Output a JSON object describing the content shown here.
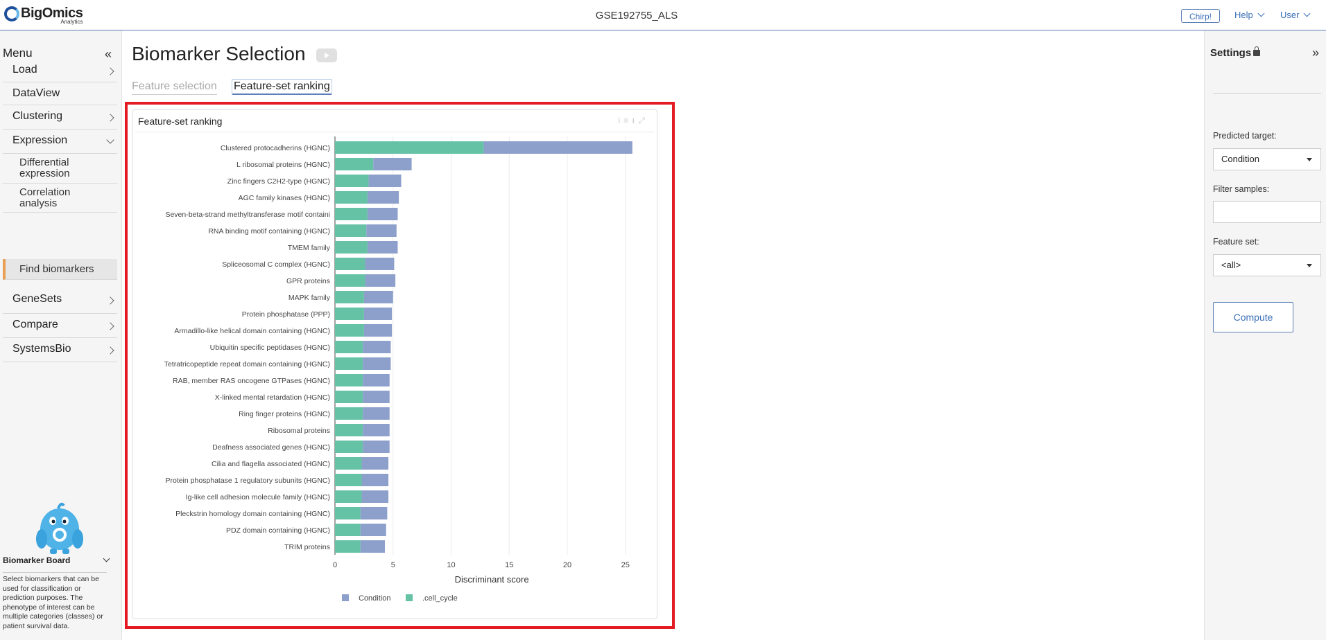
{
  "header": {
    "logo_main": "BigOmics",
    "logo_sub": "Analytics",
    "dataset": "GSE192755_ALS",
    "chirp": "Chirp!",
    "help": "Help",
    "user": "User"
  },
  "sidebar": {
    "title": "Menu",
    "items": [
      {
        "label": "Load"
      },
      {
        "label": "DataView"
      },
      {
        "label": "Clustering"
      },
      {
        "label": "Expression"
      },
      {
        "label": "Differential expression"
      },
      {
        "label": "Correlation analysis"
      },
      {
        "label": "Find biomarkers"
      },
      {
        "label": "GeneSets"
      },
      {
        "label": "Compare"
      },
      {
        "label": "SystemsBio"
      }
    ],
    "board_title": "Biomarker Board",
    "board_desc": "Select biomarkers that can be used for classification or prediction purposes. The phenotype of interest can be multiple categories (classes) or patient survival data."
  },
  "main": {
    "title": "Biomarker Selection",
    "tabs": [
      {
        "label": "Feature selection"
      },
      {
        "label": "Feature-set ranking"
      }
    ],
    "card_title": "Feature-set ranking"
  },
  "settings": {
    "title": "Settings",
    "predicted_target_label": "Predicted target:",
    "predicted_target_value": "Condition",
    "filter_samples_label": "Filter samples:",
    "feature_set_label": "Feature set:",
    "feature_set_value": "<all>",
    "compute_label": "Compute"
  },
  "chart_data": {
    "type": "bar",
    "orientation": "horizontal",
    "stacked": true,
    "xlabel": "Discriminant score",
    "xlim": [
      0,
      27
    ],
    "xticks": [
      0,
      5,
      10,
      15,
      20,
      25
    ],
    "categories": [
      "Clustered protocadherins (HGNC)",
      "L ribosomal proteins (HGNC)",
      "Zinc fingers C2H2-type (HGNC)",
      "AGC family kinases (HGNC)",
      "Seven-beta-strand methyltransferase motif containi",
      "RNA binding motif containing (HGNC)",
      "TMEM family",
      "Spliceosomal C complex (HGNC)",
      "GPR proteins",
      "MAPK family",
      "Protein phosphatase (PPP)",
      "Armadillo-like helical domain containing (HGNC)",
      "Ubiquitin specific peptidases (HGNC)",
      "Tetratricopeptide repeat domain containing (HGNC)",
      "RAB, member RAS oncogene GTPases (HGNC)",
      "X-linked mental retardation (HGNC)",
      "Ring finger proteins (HGNC)",
      "Ribosomal proteins",
      "Deafness associated genes (HGNC)",
      "Cilia and flagella associated (HGNC)",
      "Protein phosphatase 1 regulatory subunits (HGNC)",
      "Ig-like cell adhesion molecule family (HGNC)",
      "Pleckstrin homology domain containing (HGNC)",
      "PDZ domain containing (HGNC)",
      "TRIM proteins"
    ],
    "series": [
      {
        "name": ".cell_cycle",
        "color": "#66c2a5",
        "values": [
          12.8,
          3.3,
          2.9,
          2.8,
          2.8,
          2.7,
          2.8,
          2.6,
          2.6,
          2.5,
          2.5,
          2.5,
          2.4,
          2.4,
          2.4,
          2.4,
          2.4,
          2.4,
          2.4,
          2.3,
          2.3,
          2.3,
          2.2,
          2.2,
          2.2
        ]
      },
      {
        "name": "Condition",
        "color": "#8da0cb",
        "values": [
          12.8,
          3.3,
          2.8,
          2.7,
          2.6,
          2.6,
          2.6,
          2.5,
          2.6,
          2.5,
          2.4,
          2.4,
          2.4,
          2.4,
          2.3,
          2.3,
          2.3,
          2.3,
          2.3,
          2.3,
          2.3,
          2.3,
          2.3,
          2.2,
          2.1
        ]
      }
    ],
    "legend": [
      "Condition",
      ".cell_cycle"
    ],
    "grid": true
  }
}
